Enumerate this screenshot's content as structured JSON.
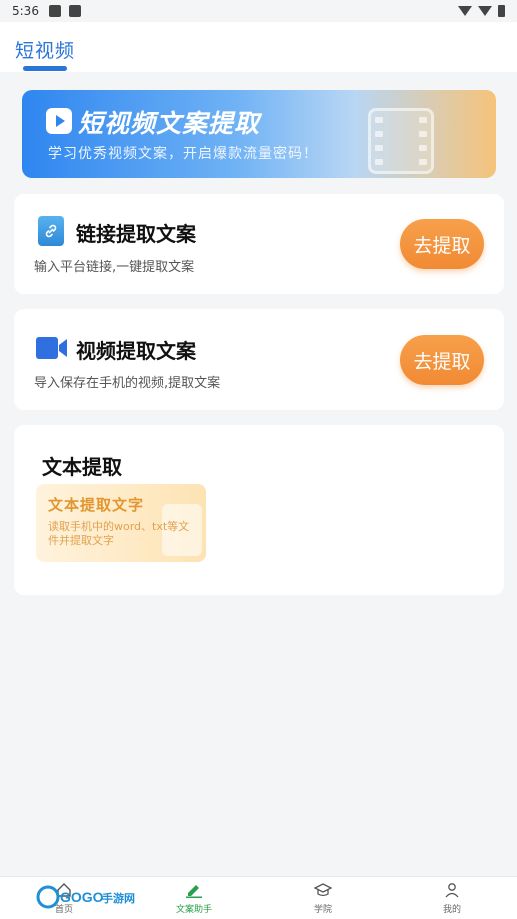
{
  "status": {
    "time": "5:36"
  },
  "header": {
    "title": "短视频"
  },
  "banner": {
    "title": "短视频文案提取",
    "subtitle": "学习优秀视频文案，开启爆款流量密码！"
  },
  "cards": [
    {
      "title": "链接提取文案",
      "desc": "输入平台链接,一键提取文案",
      "button": "去提取",
      "icon": "link-icon"
    },
    {
      "title": "视频提取文案",
      "desc": "导入保存在手机的视频,提取文案",
      "button": "去提取",
      "icon": "video-camera-icon"
    }
  ],
  "text_section": {
    "title": "文本提取",
    "card_title": "文本提取文字",
    "card_sub": "读取手机中的word、txt等文件并提取文字"
  },
  "tabs": [
    {
      "label": "首页",
      "icon": "home-icon"
    },
    {
      "label": "文案助手",
      "icon": "pen-icon",
      "active": true
    },
    {
      "label": "学院",
      "icon": "graduation-cap-icon"
    },
    {
      "label": "我的",
      "icon": "user-icon"
    }
  ],
  "watermark": {
    "text": "GOGO手游网"
  },
  "colors": {
    "primary": "#2b74d9",
    "accent": "#f18a33",
    "active_tab": "#2aa04a"
  }
}
